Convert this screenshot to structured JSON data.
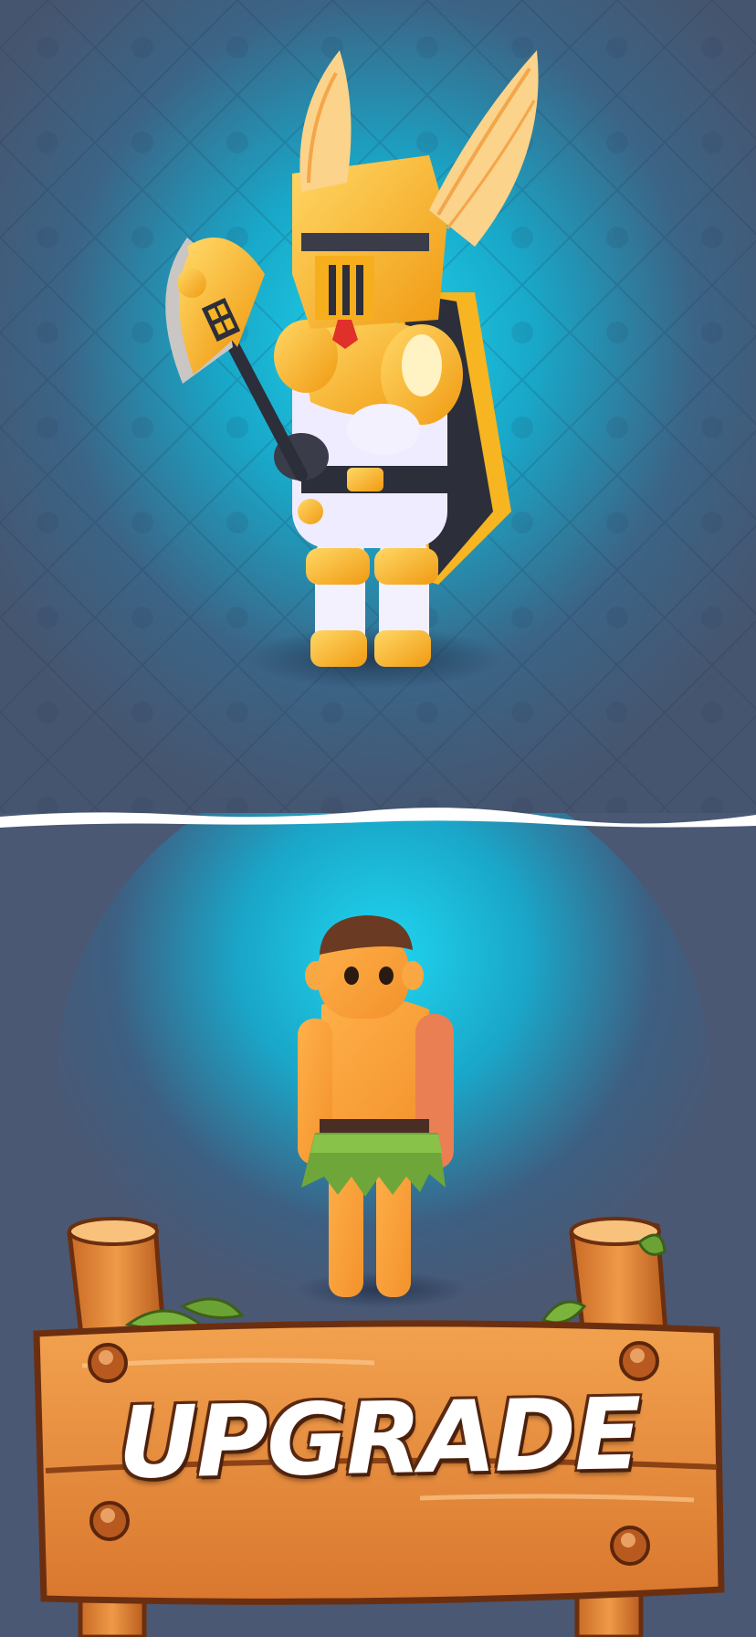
{
  "scene": {
    "top_character": "golden-winged-knight",
    "bottom_character": "caveman-in-grass-skirt"
  },
  "sign": {
    "label": "UPGRADE"
  },
  "colors": {
    "background": "#4a5874",
    "glow": "#1fc4e0",
    "gold": "#f7b21f",
    "wood": "#e58a3c",
    "wood_dark": "#7a3a14"
  }
}
